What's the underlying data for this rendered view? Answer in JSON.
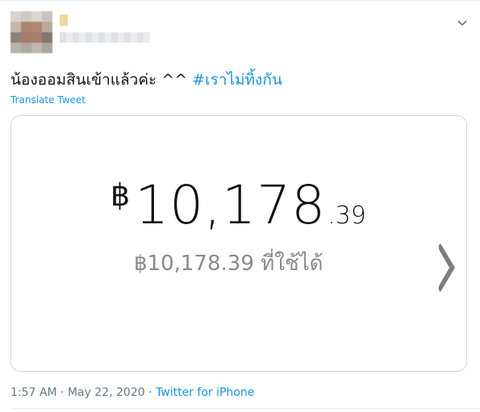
{
  "tweet": {
    "text": "น้องออมสินเข้าแล้วค่ะ ^^ ",
    "hashtag": "#เราไม่ทิ้งกัน",
    "translate_label": "Translate Tweet"
  },
  "card": {
    "currency_symbol": "฿",
    "amount_main": "10,178",
    "amount_decimal": ".39",
    "available_text": "฿10,178.39 ที่ใช้ได้"
  },
  "meta": {
    "time": "1:57 AM",
    "separator1": " · ",
    "date": "May 22, 2020",
    "separator2": " · ",
    "source": "Twitter for iPhone"
  },
  "colors": {
    "link": "#1b95e0",
    "text": "#14171a",
    "muted": "#657786",
    "border": "#ccd6dd"
  },
  "icons": {
    "caret": "chevron-down-icon",
    "card_next": "chevron-right-icon"
  }
}
